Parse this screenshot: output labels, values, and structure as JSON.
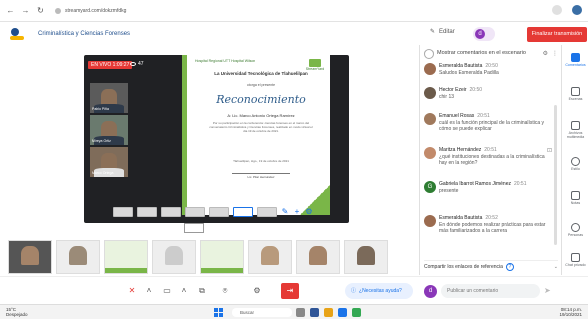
{
  "browser": {
    "url": "streamyard.com/dokzmfdkg",
    "nav": [
      "←",
      "→",
      "↻"
    ]
  },
  "header": {
    "title": "Criminalística y Ciencias Forenses",
    "edit_label": "Editar",
    "user_initial": "d",
    "end_label": "Finalizar transmisión"
  },
  "stage": {
    "live_label": "EN VIVO 1:09:27",
    "viewers": "47",
    "cams": [
      {
        "label": "Pablo Piña"
      },
      {
        "label": "Mireya Ortiz"
      },
      {
        "label": "Marco Ortega"
      }
    ]
  },
  "certificate": {
    "top_text": "Hospital Regional   UTT   Hospital Wilson",
    "university": "La Universidad Tecnológica de Tlahuelilpan",
    "granted": "otorga el presente",
    "title": "Reconocimiento",
    "name": "A: Lic. Marco Antonio Ortega Ramírez",
    "body": "Por su participación en la conferencia: ciencias forenses en el marco del conversatorio Criminalística y Ciencias Forenses, realizado en modo virtual el día 19 de octubre de 2021.",
    "place": "Tlahuelilpan, Hgo., 19 de octubre de 2021",
    "signer": "Lic. Pilar Hernández",
    "logo_text": "StreamYard"
  },
  "chat": {
    "header": "Mostrar comentarios en el escenario",
    "messages": [
      {
        "name": "Esmeralda Bautista",
        "time": "20:50",
        "text": "Saludos Esmeralda Padilla",
        "avatar": ""
      },
      {
        "name": "Hector Ezeir",
        "time": "20:50",
        "text": "chir 13",
        "avatar": ""
      },
      {
        "name": "Emanuel Rosas",
        "time": "20:51",
        "text": "cuál es la función principal de la criminalística y cómo se puede explicar",
        "avatar": ""
      },
      {
        "name": "Maritza Hernández",
        "time": "20:51",
        "text": "¿qué instituciones destinadas a la criminalística hay en la región?",
        "avatar": ""
      },
      {
        "name": "Gabriela Ibarrot Ramos Jiménez",
        "time": "20:51",
        "text": "presente",
        "avatar": "G"
      },
      {
        "name": "Esmeralda Bautista",
        "time": "20:52",
        "text": "En dónde podemos realizar prácticas para estar más familiarizados a la carrera",
        "avatar": ""
      }
    ],
    "share_label": "Compartir los enlaces de referencia"
  },
  "rail": {
    "items": [
      {
        "label": "Comentarios",
        "active": true
      },
      {
        "label": "Escenas",
        "active": false
      },
      {
        "label": "Archivos multimedia",
        "active": false
      },
      {
        "label": "Estilo",
        "active": false
      },
      {
        "label": "Notas",
        "active": false
      },
      {
        "label": "Personas",
        "active": false
      },
      {
        "label": "Chat privado",
        "active": false
      }
    ]
  },
  "controls": {
    "help_label": "¿Necesitas ayuda?",
    "comment_placeholder": "Publicar un comentario",
    "comment_avatar": "d"
  },
  "taskbar": {
    "weather_temp": "15°C",
    "weather_desc": "Despejado",
    "search_label": "Buscar",
    "time": "08:14 p.m.",
    "date": "19/10/2021"
  }
}
